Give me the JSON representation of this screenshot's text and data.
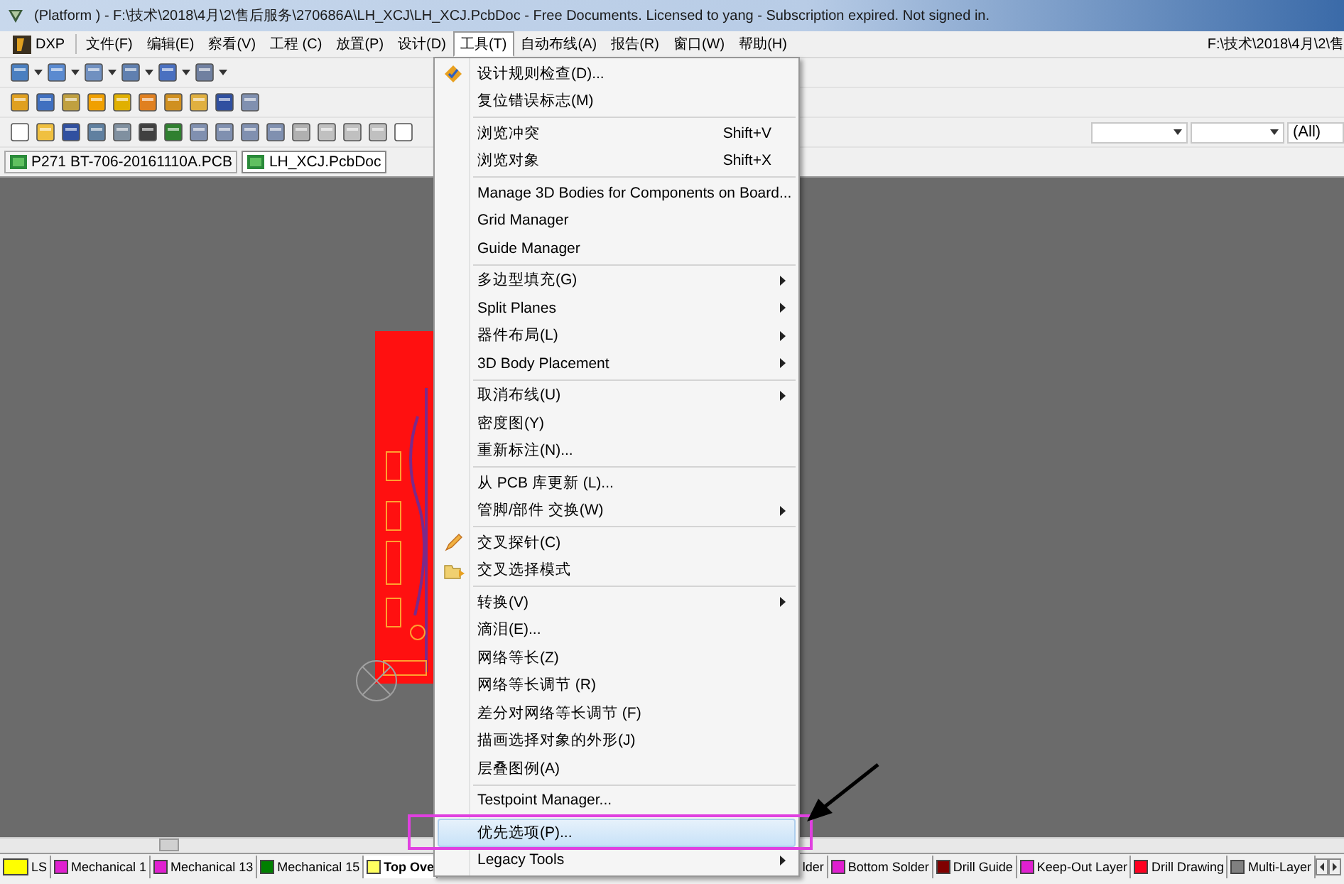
{
  "window": {
    "title": "(Platform ) - F:\\技术\\2018\\4月\\2\\售后服务\\270686A\\LH_XCJ\\LH_XCJ.PcbDoc - Free Documents. Licensed to yang - Subscription expired. Not signed in."
  },
  "menu_bar": {
    "items": [
      {
        "label": "DXP",
        "selected": false
      },
      {
        "label": "文件(F)",
        "selected": false
      },
      {
        "label": "编辑(E)",
        "selected": false
      },
      {
        "label": "察看(V)",
        "selected": false
      },
      {
        "label": "工程 (C)",
        "selected": false
      },
      {
        "label": "放置(P)",
        "selected": false
      },
      {
        "label": "设计(D)",
        "selected": false
      },
      {
        "label": "工具(T)",
        "selected": true
      },
      {
        "label": "自动布线(A)",
        "selected": false
      },
      {
        "label": "报告(R)",
        "selected": false
      },
      {
        "label": "窗口(W)",
        "selected": false
      },
      {
        "label": "帮助(H)",
        "selected": false
      }
    ],
    "path": "F:\\技术\\2018\\4月\\2\\售"
  },
  "toolbar": {
    "filter_value": "(All)"
  },
  "document_tabs": [
    {
      "label": "P271 BT-706-20161110A.PCB",
      "selected": false
    },
    {
      "label": "LH_XCJ.PcbDoc",
      "selected": true
    }
  ],
  "tools_menu": {
    "groups": [
      [
        {
          "label": "设计规则检查(D)...",
          "submenu": false,
          "selected": false
        },
        {
          "label": "复位错误标志(M)",
          "submenu": false,
          "selected": false
        }
      ],
      [
        {
          "label": "浏览冲突",
          "shortcut": "Shift+V",
          "submenu": false,
          "selected": false
        },
        {
          "label": "浏览对象",
          "shortcut": "Shift+X",
          "submenu": false,
          "selected": false
        }
      ],
      [
        {
          "label": "Manage 3D Bodies for Components on Board...",
          "submenu": false,
          "selected": false
        },
        {
          "label": "Grid Manager",
          "submenu": false,
          "selected": false
        },
        {
          "label": "Guide Manager",
          "submenu": false,
          "selected": false
        }
      ],
      [
        {
          "label": "多边型填充(G)",
          "submenu": true,
          "selected": false
        },
        {
          "label": "Split Planes",
          "submenu": true,
          "selected": false
        },
        {
          "label": "器件布局(L)",
          "submenu": true,
          "selected": false
        },
        {
          "label": "3D Body Placement",
          "submenu": true,
          "selected": false
        }
      ],
      [
        {
          "label": "取消布线(U)",
          "submenu": true,
          "selected": false
        },
        {
          "label": "密度图(Y)",
          "submenu": false,
          "selected": false
        },
        {
          "label": "重新标注(N)...",
          "submenu": false,
          "selected": false
        }
      ],
      [
        {
          "label": "从 PCB 库更新 (L)...",
          "submenu": false,
          "selected": false
        },
        {
          "label": "管脚/部件 交换(W)",
          "submenu": true,
          "selected": false
        }
      ],
      [
        {
          "label": "交叉探针(C)",
          "submenu": false,
          "selected": false
        },
        {
          "label": "交叉选择模式",
          "submenu": false,
          "selected": false
        }
      ],
      [
        {
          "label": "转换(V)",
          "submenu": true,
          "selected": false
        },
        {
          "label": "滴泪(E)...",
          "submenu": false,
          "selected": false
        },
        {
          "label": "网络等长(Z)",
          "submenu": false,
          "selected": false
        },
        {
          "label": "网络等长调节 (R)",
          "submenu": false,
          "selected": false
        },
        {
          "label": "差分对网络等长调节 (F)",
          "submenu": false,
          "selected": false
        },
        {
          "label": "描画选择对象的外形(J)",
          "submenu": false,
          "selected": false
        },
        {
          "label": "层叠图例(A)",
          "submenu": false,
          "selected": false
        }
      ],
      [
        {
          "label": "Testpoint Manager...",
          "submenu": false,
          "selected": false
        }
      ],
      [
        {
          "label": "优先选项(P)...",
          "submenu": false,
          "selected": true
        },
        {
          "label": "Legacy Tools",
          "submenu": true,
          "selected": false
        }
      ]
    ]
  },
  "layer_tabs": [
    {
      "label": "LS",
      "color": "#ffff00",
      "selected": false
    },
    {
      "label": "Mechanical 1",
      "color": "#e020d0",
      "selected": false
    },
    {
      "label": "Mechanical 13",
      "color": "#e020d0",
      "selected": false
    },
    {
      "label": "Mechanical 15",
      "color": "#008000",
      "selected": false
    },
    {
      "label": "Top Ove",
      "color": "#ffff60",
      "selected": true
    }
  ],
  "layer_tabs_after_menu": [
    {
      "label": "lder",
      "selected": false
    },
    {
      "label": "Bottom Solder",
      "color": "#e020d0",
      "selected": false
    },
    {
      "label": "Drill Guide",
      "color": "#800000",
      "selected": false
    },
    {
      "label": "Keep-Out Layer",
      "color": "#e020d0",
      "selected": false
    },
    {
      "label": "Drill Drawing",
      "color": "#ff0020",
      "selected": false
    },
    {
      "label": "Multi-Layer",
      "color": "#808080",
      "selected": false
    }
  ]
}
